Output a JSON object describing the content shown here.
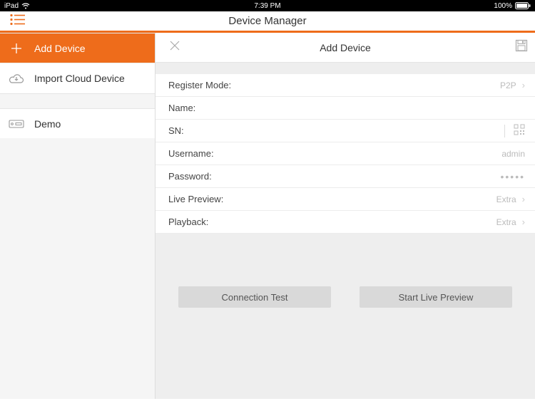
{
  "status": {
    "device": "iPad",
    "time": "7:39 PM",
    "battery": "100%"
  },
  "nav": {
    "title": "Device Manager"
  },
  "sidebar": {
    "addDevice": "Add Device",
    "importCloud": "Import Cloud Device",
    "demo": "Demo"
  },
  "panel": {
    "title": "Add Device"
  },
  "form": {
    "registerMode": {
      "label": "Register Mode:",
      "value": "P2P"
    },
    "name": {
      "label": "Name:",
      "value": ""
    },
    "sn": {
      "label": "SN:",
      "value": ""
    },
    "username": {
      "label": "Username:",
      "value": "admin"
    },
    "password": {
      "label": "Password:",
      "value": "•••••"
    },
    "livePreview": {
      "label": "Live Preview:",
      "value": "Extra"
    },
    "playback": {
      "label": "Playback:",
      "value": "Extra"
    }
  },
  "buttons": {
    "connectionTest": "Connection Test",
    "startLivePreview": "Start Live Preview"
  }
}
